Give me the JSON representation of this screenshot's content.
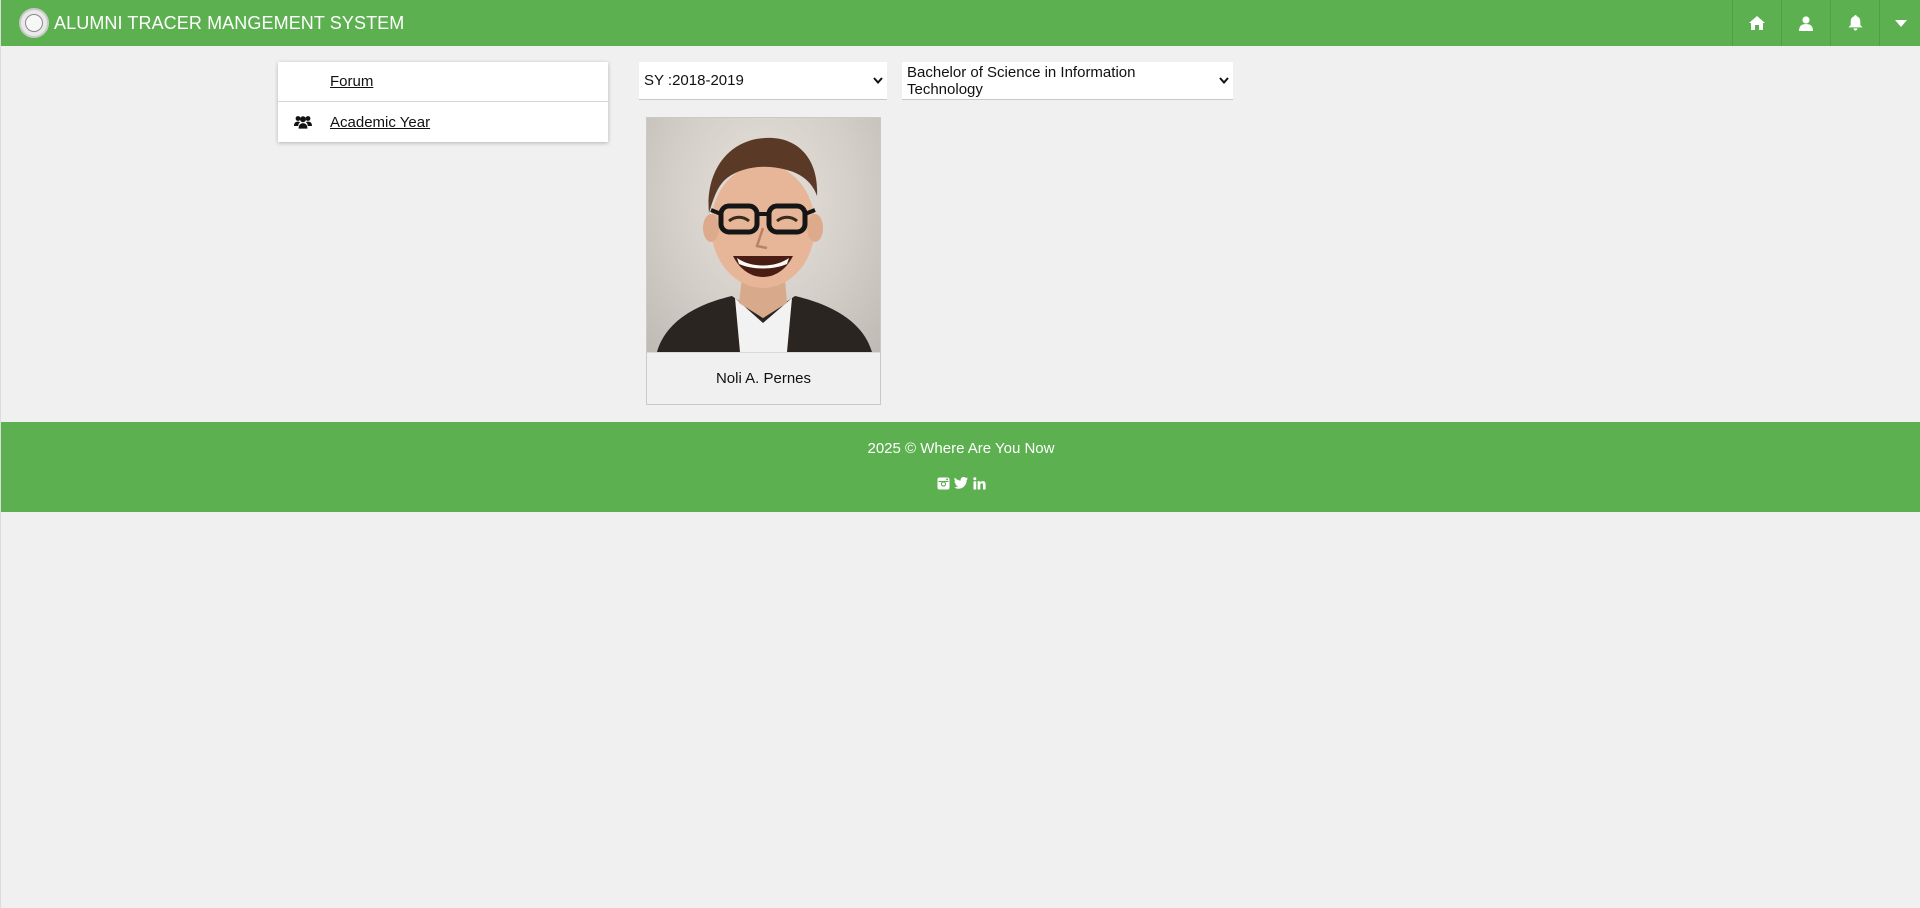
{
  "header": {
    "title": "ALUMNI TRACER MANGEMENT SYSTEM",
    "nav_icons": [
      "home-icon",
      "user-icon",
      "bell-icon",
      "caret-down-icon"
    ]
  },
  "sidebar": {
    "items": [
      {
        "label": "Forum",
        "icon": ""
      },
      {
        "label": "Academic Year",
        "icon": "users-icon"
      }
    ]
  },
  "filters": {
    "school_year": "SY :2018-2019",
    "course": "Bachelor of Science in Information Technology"
  },
  "alumni": [
    {
      "name": "Noli A. Pernes"
    }
  ],
  "footer": {
    "text": "2025 © Where Are You Now",
    "social_icons": [
      "instagram-icon",
      "twitter-icon",
      "linkedin-icon"
    ]
  },
  "colors": {
    "brand_green": "#5cb050",
    "background": "#f0f0f0"
  }
}
